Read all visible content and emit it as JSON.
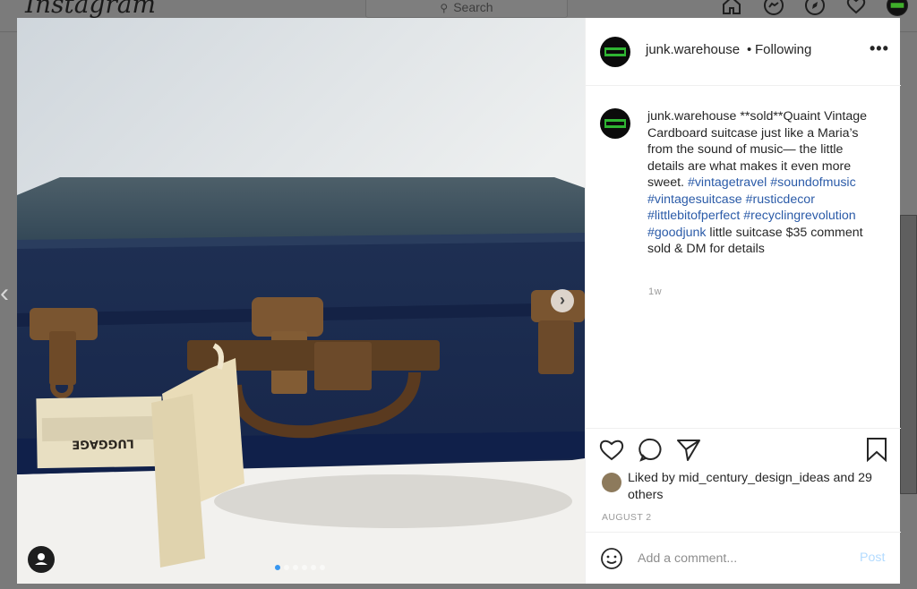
{
  "app": {
    "logo_text": "Instagram"
  },
  "header": {
    "search_placeholder": "Search"
  },
  "post": {
    "username": "junk.warehouse",
    "follow_separator": "•",
    "follow_status": "Following",
    "more_label": "•••",
    "caption_user": "junk.warehouse",
    "caption_parts": [
      {
        "type": "text",
        "value": " **sold**Quaint Vintage Cardboard suitcase just like a Maria’s from the sound of music— the little details are what makes it even more sweet. "
      },
      {
        "type": "tag",
        "value": "#vintagetravel"
      },
      {
        "type": "text",
        "value": " "
      },
      {
        "type": "tag",
        "value": "#soundofmusic"
      },
      {
        "type": "text",
        "value": " "
      },
      {
        "type": "tag",
        "value": "#vintagesuitcase"
      },
      {
        "type": "text",
        "value": " "
      },
      {
        "type": "tag",
        "value": "#rusticdecor"
      },
      {
        "type": "text",
        "value": " "
      },
      {
        "type": "tag",
        "value": "#littlebitofperfect"
      },
      {
        "type": "text",
        "value": " "
      },
      {
        "type": "tag",
        "value": "#recyclingrevolution"
      },
      {
        "type": "text",
        "value": " "
      },
      {
        "type": "tag",
        "value": "#goodjunk"
      },
      {
        "type": "text",
        "value": " little suitcase $35 comment sold & DM for details"
      }
    ],
    "caption_age": "1w",
    "liked_prefix": "Liked by ",
    "liked_user": "mid_century_design_ideas",
    "liked_suffix": " and 29 others",
    "date": "AUGUST 2",
    "carousel": {
      "total": 6,
      "active_index": 0
    },
    "tag_label_on_photo": "LUGGAGE"
  },
  "comment_box": {
    "placeholder": "Add a comment...",
    "post_label": "Post"
  },
  "icons": {
    "header": [
      "home-icon",
      "messenger-icon",
      "explore-icon",
      "activity-heart-icon",
      "profile-avatar"
    ],
    "actions": [
      "like-heart-icon",
      "comment-bubble-icon",
      "share-send-icon",
      "save-bookmark-icon"
    ],
    "other": [
      "emoji-smile-icon",
      "user-tag-icon",
      "next-photo-chevron-icon",
      "previous-post-chevron-icon"
    ]
  },
  "colors": {
    "hashtag": "#2b5ba8",
    "accent": "#3897f0",
    "post_disabled": "#b3dbff",
    "muted": "#9a9a9a"
  }
}
